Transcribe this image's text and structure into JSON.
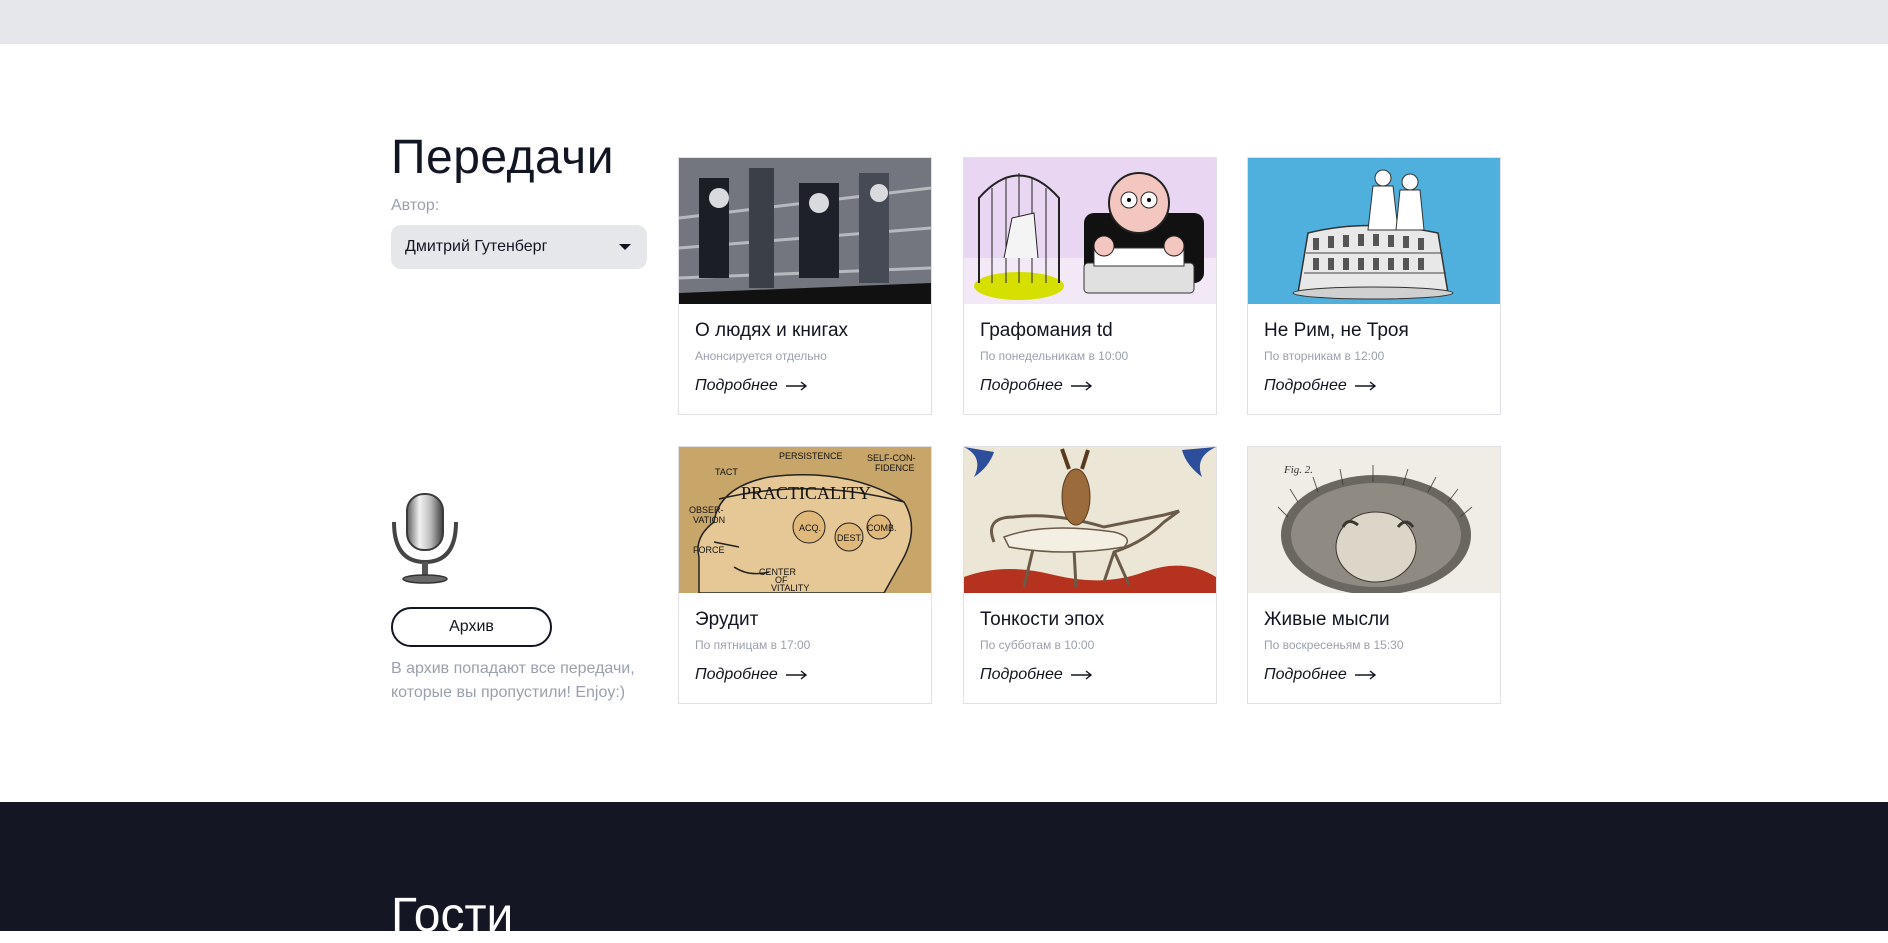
{
  "page": {
    "section_title": "Передачи",
    "author_label": "Автор:",
    "author_select": {
      "value": "Дмитрий Гутенберг"
    },
    "archive": {
      "button_label": "Архив",
      "note": "В архив попадают все передачи, которые вы пропустили! Enjoy:)"
    },
    "footer_title": "Гости"
  },
  "cards": [
    {
      "title": "О людях и книгах",
      "schedule": "Анонсируется отдельно",
      "more": "Подробнее",
      "image": "printing-house-engraving"
    },
    {
      "title": "Графомания td",
      "schedule": "По понедельникам в 10:00",
      "more": "Подробнее",
      "image": "writer-typewriter-cartoon"
    },
    {
      "title": "Не Рим, не Троя",
      "schedule": "По вторникам в 12:00",
      "more": "Подробнее",
      "image": "colosseum-statue"
    },
    {
      "title": "Эрудит",
      "schedule": "По пятницам в 17:00",
      "more": "Подробнее",
      "image": "phrenology-head",
      "image_text": {
        "main": "PRACTICALITY",
        "labels": [
          "TACT",
          "PERSISTENCE",
          "SELF-CON-",
          "FIDENCE",
          "OBSER-",
          "VATION",
          "FORCE",
          "ACQ.",
          "DEST.",
          "COMB.",
          "CENTER",
          "OF",
          "VITALITY"
        ]
      }
    },
    {
      "title": "Тонкости эпох",
      "schedule": "По субботам в 10:00",
      "more": "Подробнее",
      "image": "medieval-hare-riding-dog"
    },
    {
      "title": "Живые мысли",
      "schedule": "По воскресеньям в 15:30",
      "more": "Подробнее",
      "image": "hedgehog-creature-engraving",
      "image_text": {
        "caption": "Fig. 2."
      }
    }
  ],
  "colors": {
    "dark": "#121522",
    "muted": "#9aa0ad",
    "panel": "#e6e7eb",
    "footer": "#141723",
    "border": "#dfe1e6"
  }
}
